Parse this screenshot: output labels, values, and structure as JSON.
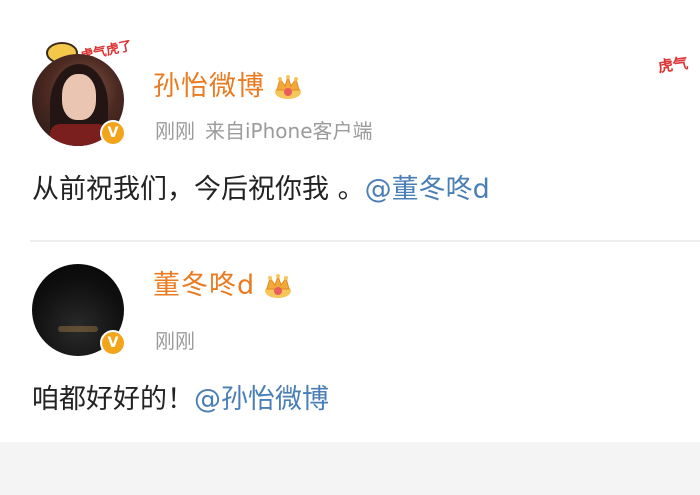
{
  "posts": [
    {
      "username": "孙怡微博",
      "time": "刚刚",
      "source": "来自iPhone客户端",
      "text": "从前祝我们，今后祝你我 。",
      "mention": "@董冬咚d",
      "avatar_decoration_text": "虎气虎了",
      "verified_badge": "V"
    },
    {
      "username": "董冬咚d",
      "time": "刚刚",
      "text": "咱都好好的！",
      "mention": "@孙怡微博",
      "verified_badge": "V"
    }
  ],
  "corner_decoration_text": "虎气",
  "colors": {
    "username": "#ea7b21",
    "mention": "#4a7fb5",
    "meta": "#9b9b9b",
    "badge": "#f2a51a"
  },
  "icons": [
    "crown-icon",
    "verified-v-icon",
    "tiger-sticker-icon"
  ]
}
